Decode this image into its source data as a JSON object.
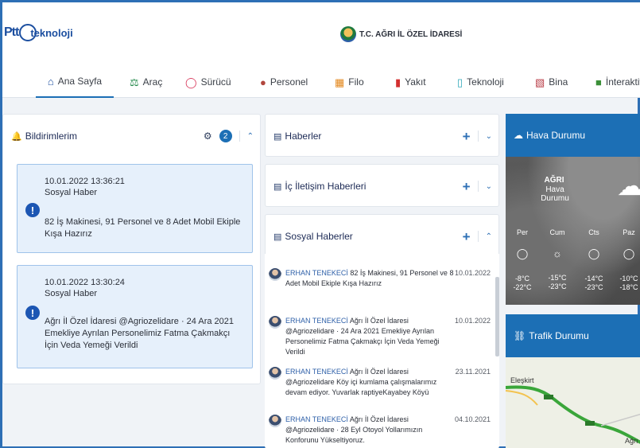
{
  "header": {
    "logo_text": "Ptt",
    "logo_sub": "teknoloji",
    "center_title": "T.C. AĞRI İL ÖZEL İDARESİ"
  },
  "nav": {
    "items": [
      {
        "label": "Ana Sayfa",
        "icon": "home-icon",
        "color": "#1c4fa0"
      },
      {
        "label": "Araç",
        "icon": "car-icon",
        "color": "#22884a"
      },
      {
        "label": "Sürücü",
        "icon": "steering-icon",
        "color": "#d8365a"
      },
      {
        "label": "Personel",
        "icon": "person-icon",
        "color": "#b1463d"
      },
      {
        "label": "Filo",
        "icon": "fleet-icon",
        "color": "#e3861a"
      },
      {
        "label": "Yakıt",
        "icon": "fuel-icon",
        "color": "#d33030"
      },
      {
        "label": "Teknoloji",
        "icon": "mobile-icon",
        "color": "#2aa6b9"
      },
      {
        "label": "Bina",
        "icon": "building-icon",
        "color": "#b83c46"
      },
      {
        "label": "İnteraktif",
        "icon": "comment-icon",
        "color": "#3b8f38"
      }
    ]
  },
  "notifications": {
    "title": "Bildirimlerim",
    "count": "2",
    "items": [
      {
        "datetime": "10.01.2022 13:36:21",
        "type": "Sosyal Haber",
        "text": "82 İş Makinesi, 91 Personel ve 8 Adet Mobil Ekiple Kışa Hazırız"
      },
      {
        "datetime": "10.01.2022 13:30:24",
        "type": "Sosyal Haber",
        "text": "Ağrı İl Özel İdaresi @Agriozelidare · 24 Ara 2021 Emekliye Ayrılan Personelimiz Fatma Çakmakçı İçin Veda Yemeği Verildi"
      }
    ]
  },
  "news_panels": {
    "haberler": "Haberler",
    "ic_iletisim": "İç İletişim Haberleri",
    "sosyal": "Sosyal Haberler"
  },
  "social_news": [
    {
      "author": "ERHAN TENEKECİ",
      "text": "82 İş Makinesi, 91 Personel ve 8 Adet Mobil Ekiple Kışa Hazırız",
      "date": "10.01.2022"
    },
    {
      "author": "ERHAN TENEKECİ",
      "text": "Ağrı İl Özel İdaresi @Agriozelidare · 24 Ara 2021 Emekliye Ayrılan Personelimiz Fatma Çakmakçı İçin Veda Yemeği Verildi",
      "date": "10.01.2022"
    },
    {
      "author": "ERHAN TENEKECİ",
      "text": "Ağrı İl Özel İdaresi @Agriozelidare Köy içi kumlama çalışmalarımız devam ediyor. Yuvarlak raptiyeKayabey Köyü",
      "date": "23.11.2021"
    },
    {
      "author": "ERHAN TENEKECİ",
      "text": "Ağrı İl Özel İdaresi @Agriozelidare · 28 Eyl Otoyol Yollarımızın Konforunu Yükseltiyoruz.",
      "date": "04.10.2021"
    }
  ],
  "weather": {
    "title": "Hava Durumu",
    "city": "AĞRI",
    "subtitle": "Hava Durumu",
    "days": [
      {
        "day": "Per",
        "icon": "moon-icon",
        "hi": "-8°C",
        "lo": "-22°C"
      },
      {
        "day": "Cum",
        "icon": "sun-cloud-icon",
        "hi": "-15°C",
        "lo": "-23°C"
      },
      {
        "day": "Cts",
        "icon": "moon-icon",
        "hi": "-14°C",
        "lo": "-23°C"
      },
      {
        "day": "Paz",
        "icon": "moon-icon",
        "hi": "-10°C",
        "lo": "-18°C"
      }
    ]
  },
  "traffic": {
    "title": "Trafik Durumu",
    "map_labels": [
      "Eleşkirt",
      "Ağrı"
    ]
  }
}
